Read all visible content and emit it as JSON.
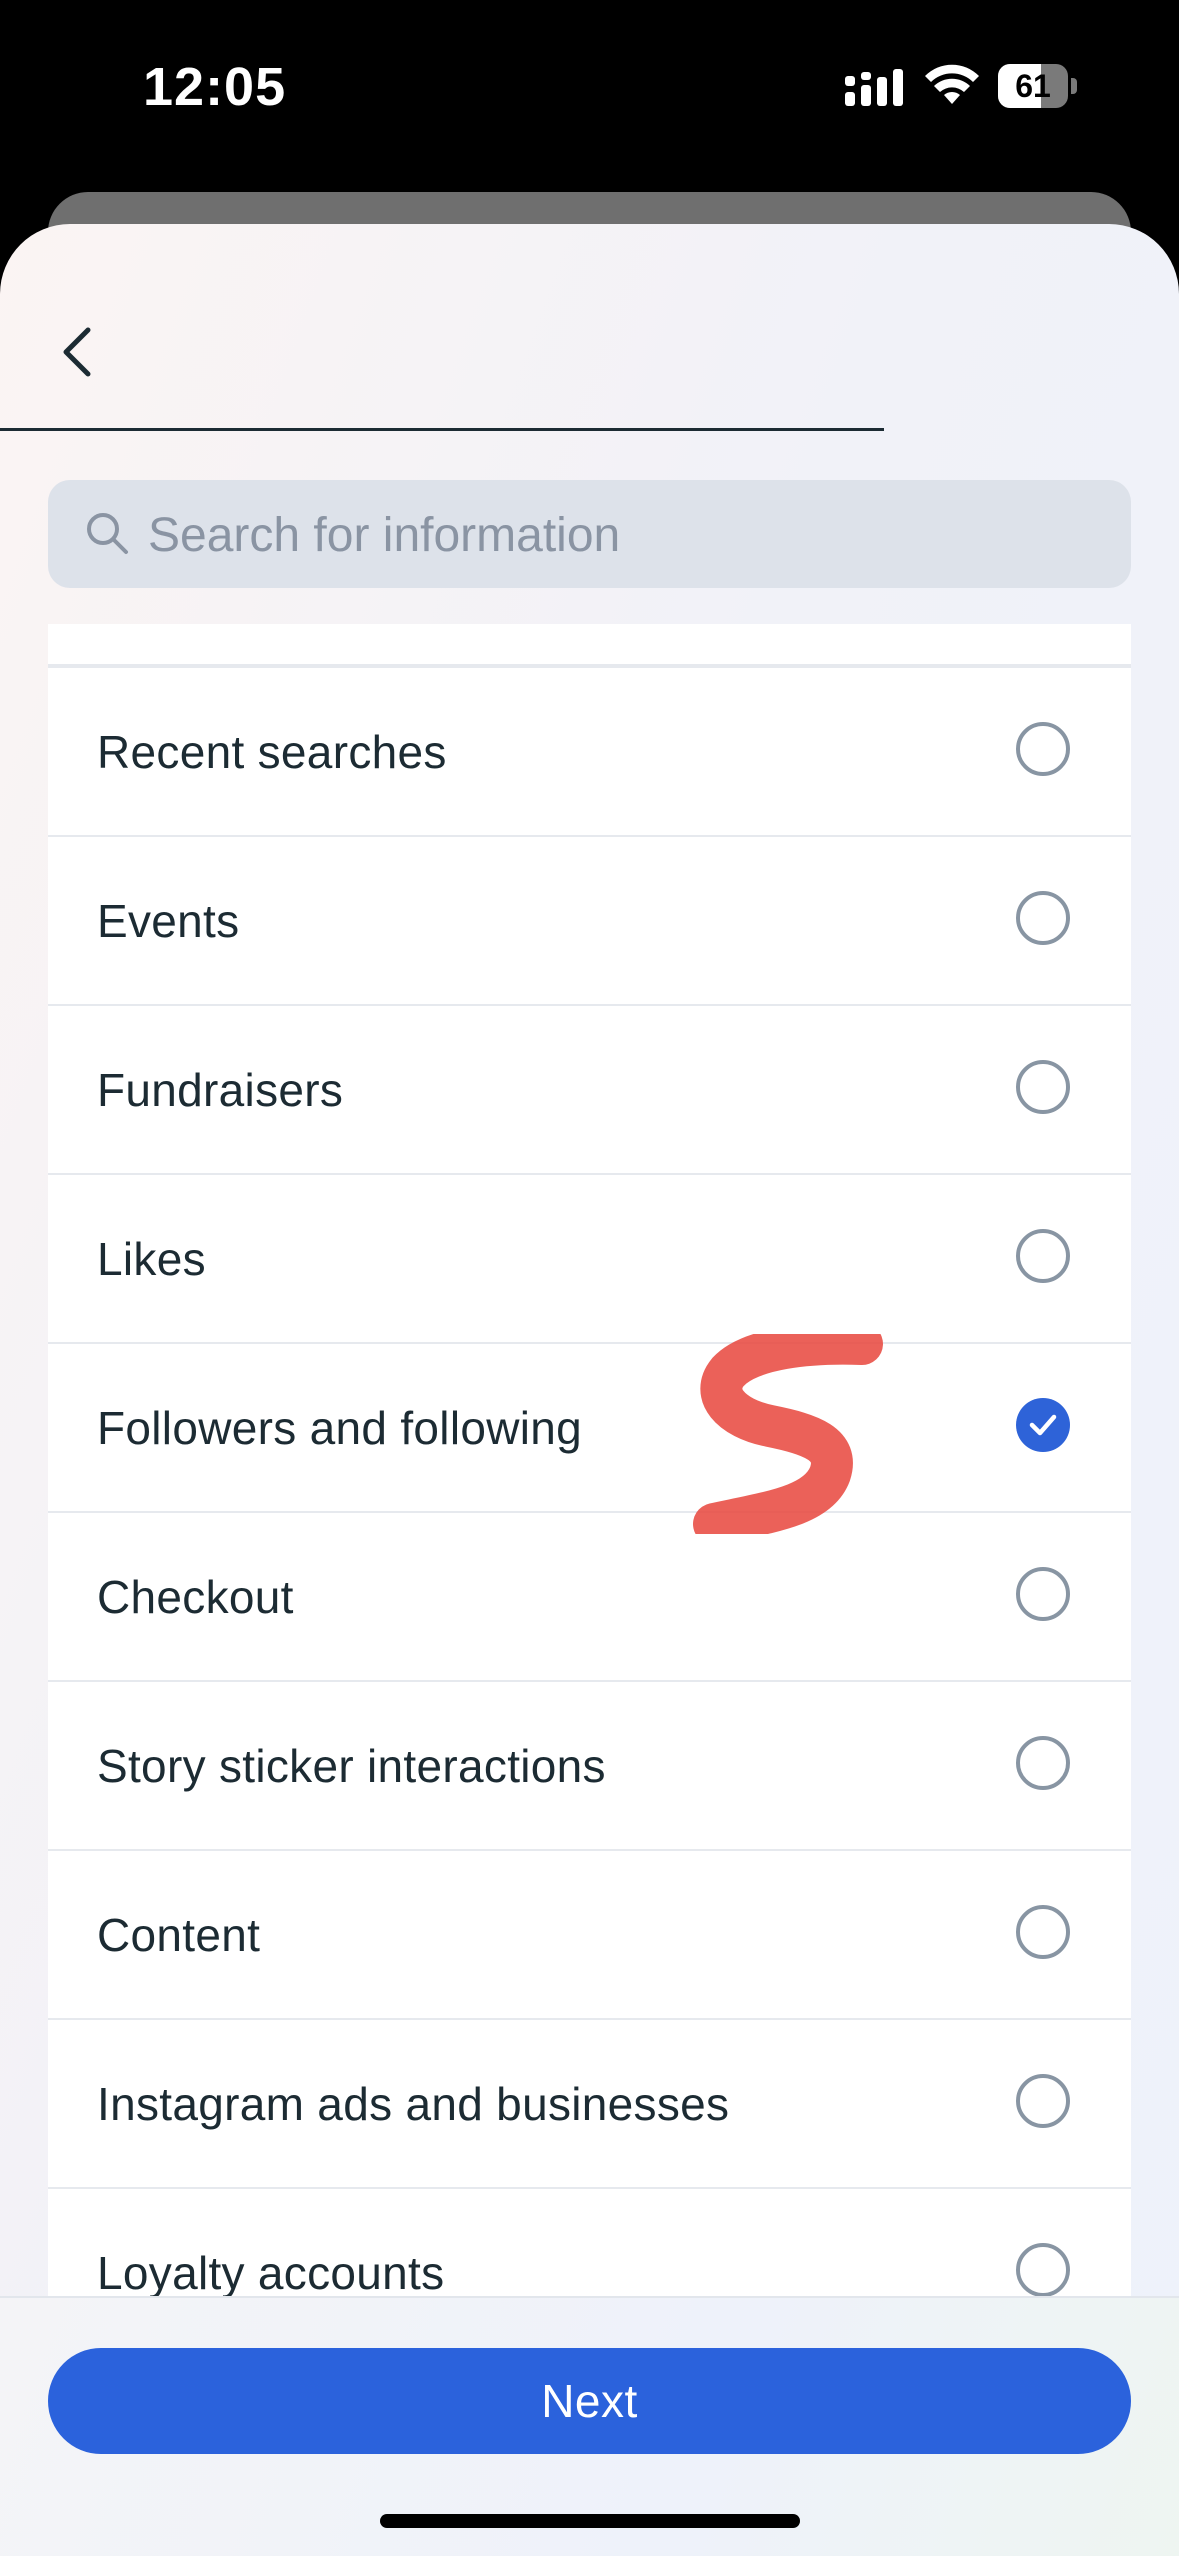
{
  "status_bar": {
    "time": "12:05",
    "battery_level": "61",
    "battery_fraction": 0.61
  },
  "search": {
    "placeholder": "Search for information",
    "value": ""
  },
  "items": [
    {
      "label": "Recent searches",
      "checked": false
    },
    {
      "label": "Events",
      "checked": false
    },
    {
      "label": "Fundraisers",
      "checked": false
    },
    {
      "label": "Likes",
      "checked": false
    },
    {
      "label": "Followers and following",
      "checked": true
    },
    {
      "label": "Checkout",
      "checked": false
    },
    {
      "label": "Story sticker interactions",
      "checked": false
    },
    {
      "label": "Content",
      "checked": false
    },
    {
      "label": "Instagram ads and businesses",
      "checked": false
    },
    {
      "label": "Loyalty accounts",
      "checked": false
    }
  ],
  "footer": {
    "next_label": "Next"
  },
  "colors": {
    "accent": "#2b62dc",
    "radio_border": "#8895a3",
    "text": "#1c2b33"
  },
  "icons": {
    "back": "chevron-left-icon",
    "search": "search-icon",
    "check": "checkmark-icon"
  }
}
